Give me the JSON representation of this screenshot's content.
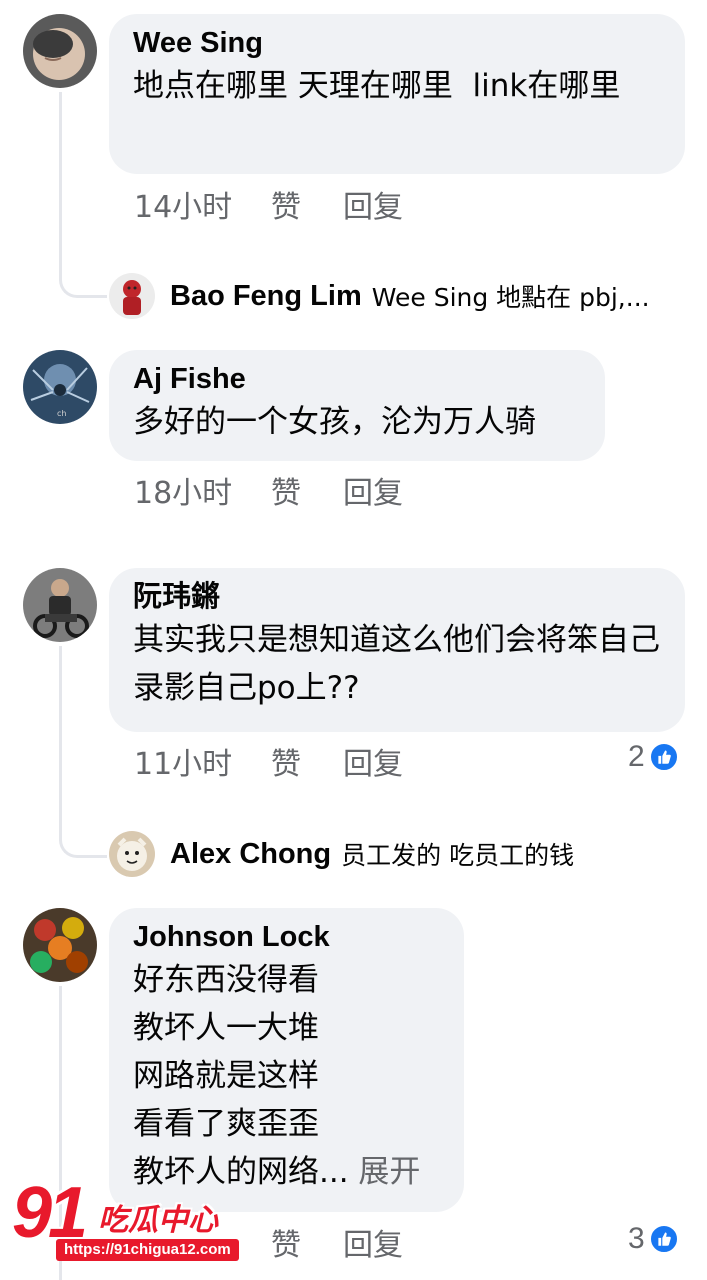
{
  "comments": [
    {
      "author": "Wee Sing",
      "text": "地点在哪里 天理在哪里  link在哪里",
      "time": "14小时",
      "like_label": "赞",
      "reply_label": "回复",
      "reply_preview": {
        "author": "Bao Feng Lim",
        "text": "Wee Sing 地點在 pbj,..."
      }
    },
    {
      "author": "Aj Fishe",
      "text": "多好的一个女孩，沦为万人骑",
      "time": "18小时",
      "like_label": "赞",
      "reply_label": "回复"
    },
    {
      "author": "阮玮鏘",
      "text": "其实我只是想知道这么他们会将笨自己录影自己po上??",
      "time": "11小时",
      "like_label": "赞",
      "reply_label": "回复",
      "reaction_count": "2",
      "reply_preview": {
        "author": "Alex Chong",
        "text": "员工发的 吃员工的钱"
      }
    },
    {
      "author": "Johnson Lock",
      "lines": [
        "好东西没得看",
        "教坏人一大堆",
        "网路就是这样",
        "看看了爽歪歪",
        "教坏人的网络..."
      ],
      "see_more": "展开",
      "like_label": "赞",
      "reply_label": "回复",
      "reaction_count": "3"
    }
  ],
  "watermark": {
    "brand_number": "91",
    "brand_name": "吃瓜中心",
    "url": "https://91chigua12.com"
  },
  "colors": {
    "bubble": "#f0f2f5",
    "meta_text": "#65676b",
    "like_blue": "#1877f2",
    "watermark_red": "#e8192c"
  }
}
